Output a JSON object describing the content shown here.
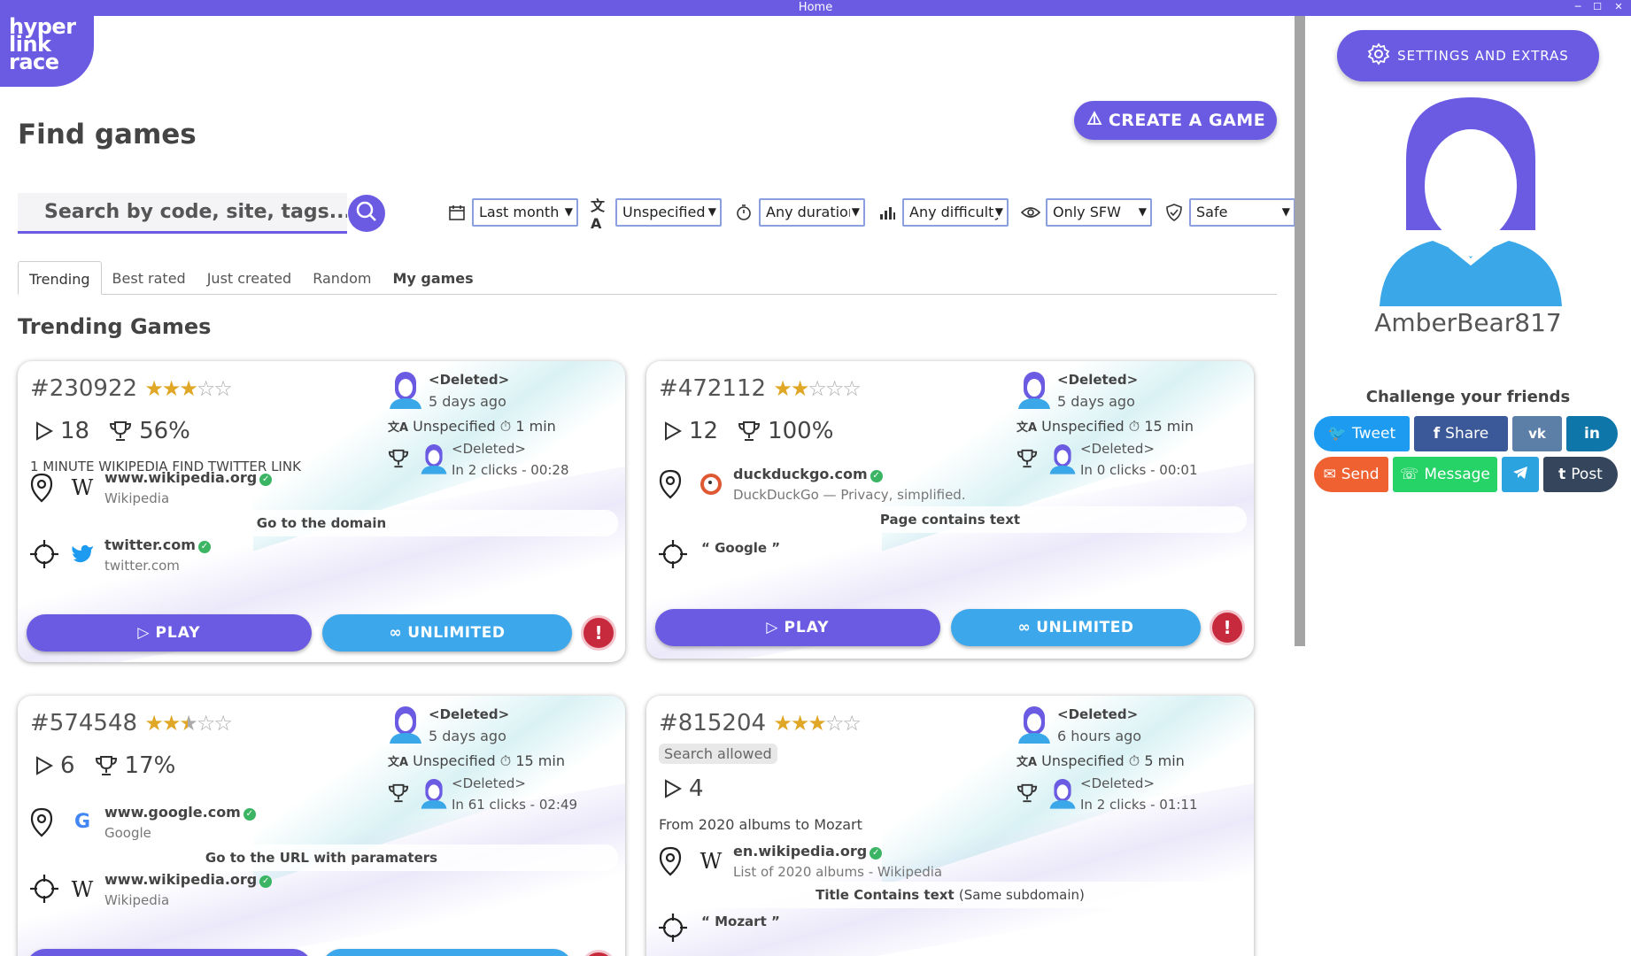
{
  "window": {
    "title": "Home",
    "minimize": "─",
    "maximize": "☐",
    "close": "✕"
  },
  "logo": {
    "line1": "hyper",
    "line2": "link",
    "line3": "race"
  },
  "header": {
    "title": "Find games",
    "create_label": "CREATE A GAME"
  },
  "search": {
    "placeholder": "Search by code, site, tags..."
  },
  "filters": [
    {
      "icon": "calendar-icon",
      "value": "Last month"
    },
    {
      "icon": "translate-icon",
      "value": "Unspecified"
    },
    {
      "icon": "timer-icon",
      "value": "Any duration"
    },
    {
      "icon": "difficulty-icon",
      "value": "Any difficulty"
    },
    {
      "icon": "eye-icon",
      "value": "Only SFW"
    },
    {
      "icon": "shield-icon",
      "value": "Safe"
    }
  ],
  "tabs": [
    "Trending",
    "Best rated",
    "Just created",
    "Random",
    "My games"
  ],
  "section_title": "Trending Games",
  "cards": [
    {
      "id": "#230922",
      "rating": 3,
      "plays": "18",
      "win": "56%",
      "desc": "1 MINUTE WIKIPEDIA FIND TWITTER LINK",
      "creator": "<Deleted>",
      "created": "5 days ago",
      "lang": "Unspecified",
      "duration": "1 min",
      "best_name": "<Deleted>",
      "best_stats": "In 2 clicks - 00:28",
      "start_domain": "www.wikipedia.org",
      "start_sub": "Wikipedia",
      "rule": "Go to the domain",
      "target_domain": "twitter.com",
      "target_sub": "twitter.com",
      "play": "PLAY",
      "unlimited": "UNLIMITED",
      "report": "!"
    },
    {
      "id": "#472112",
      "rating": 2,
      "plays": "12",
      "win": "100%",
      "creator": "<Deleted>",
      "created": "5 days ago",
      "lang": "Unspecified",
      "duration": "15 min",
      "best_name": "<Deleted>",
      "best_stats": "In 0 clicks - 00:01",
      "start_domain": "duckduckgo.com",
      "start_sub": "DuckDuckGo — Privacy, simplified.",
      "rule": "Page contains text",
      "target_text": "“ Google ”",
      "play": "PLAY",
      "unlimited": "UNLIMITED",
      "report": "!"
    },
    {
      "id": "#574548",
      "rating": 2.5,
      "plays": "6",
      "win": "17%",
      "creator": "<Deleted>",
      "created": "5 days ago",
      "lang": "Unspecified",
      "duration": "15 min",
      "best_name": "<Deleted>",
      "best_stats": "In 61 clicks - 02:49",
      "start_domain": "www.google.com",
      "start_sub": "Google",
      "rule": "Go to the URL with paramaters",
      "target_domain": "www.wikipedia.org",
      "target_sub": "Wikipedia"
    },
    {
      "id": "#815204",
      "rating": 3,
      "badge": "Search allowed",
      "plays": "4",
      "desc": "From 2020 albums to Mozart",
      "creator": "<Deleted>",
      "created": "6 hours ago",
      "lang": "Unspecified",
      "duration": "5 min",
      "best_name": "<Deleted>",
      "best_stats": "In 2 clicks - 01:11",
      "start_domain": "en.wikipedia.org",
      "start_sub": "List of 2020 albums - Wikipedia",
      "rule": "Title Contains text",
      "rule_note": "(Same subdomain)",
      "target_text": "“ Mozart ”"
    }
  ],
  "sidebar": {
    "settings_label": "SETTINGS AND EXTRAS",
    "username": "AmberBear817",
    "challenge_title": "Challenge your friends",
    "share": {
      "tweet": "Tweet",
      "share": "Share",
      "vk": "vk",
      "linkedin": "in",
      "send": "Send",
      "message": "Message",
      "post": "Post"
    }
  },
  "colors": {
    "accent": "#6a5be2",
    "blue": "#3ca7ea",
    "danger": "#c7293d",
    "success": "#3bb563"
  }
}
